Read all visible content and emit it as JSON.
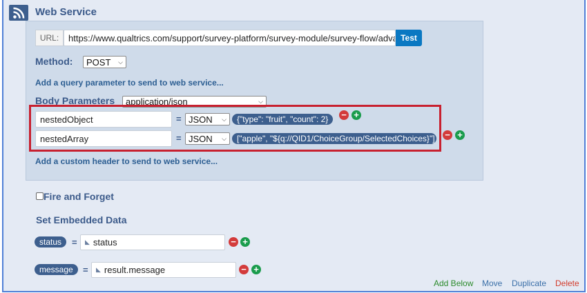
{
  "title": "Web Service",
  "url": {
    "label": "URL:",
    "value": "https://www.qualtrics.com/support/survey-platform/survey-module/survey-flow/advancec",
    "test": "Test"
  },
  "method": {
    "label": "Method:",
    "value": "POST"
  },
  "add_query": "Add a query parameter to send to web service...",
  "body": {
    "label": "Body Parameters",
    "content_type": "application/json",
    "params": [
      {
        "key": "nestedObject",
        "eq": "=",
        "type": "JSON",
        "value": "{\"type\": \"fruit\", \"count\": 2}"
      },
      {
        "key": "nestedArray",
        "eq": "=",
        "type": "JSON",
        "value": "[\"apple\", \"${q://QID1/ChoiceGroup/SelectedChoices}\"]"
      }
    ]
  },
  "add_header": "Add a custom header to send to web service...",
  "fire_forget": "Fire and Forget",
  "embedded": {
    "label": "Set Embedded Data",
    "items": [
      {
        "name": "status",
        "eq": "=",
        "value": "status"
      },
      {
        "name": "message",
        "eq": "=",
        "value": "result.message"
      }
    ]
  },
  "footer": {
    "add_below": "Add Below",
    "move": "Move",
    "duplicate": "Duplicate",
    "delete": "Delete"
  },
  "colors": {
    "accent": "#3d5f8e",
    "highlight": "#c8202f",
    "test": "#0a78c2"
  }
}
